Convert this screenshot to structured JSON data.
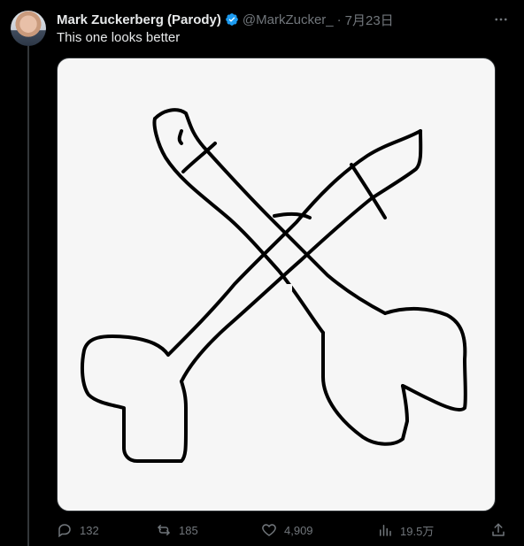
{
  "tweet": {
    "author_name": "Mark Zuckerberg (Parody)",
    "handle": "@MarkZucker_",
    "separator": "·",
    "date": "7月23日",
    "text": "This one looks better",
    "verified": true
  },
  "actions": {
    "replies": "132",
    "reposts": "185",
    "likes": "4,909",
    "views": "19.5万"
  },
  "icons": {
    "verified": "verified-badge-icon",
    "more": "more-icon",
    "reply": "reply-icon",
    "repost": "repost-icon",
    "like": "heart-icon",
    "views": "views-icon",
    "share": "share-icon"
  },
  "colors": {
    "background": "#000000",
    "text": "#e7e9ea",
    "muted": "#71767b",
    "verified_blue": "#1d9bf0"
  }
}
